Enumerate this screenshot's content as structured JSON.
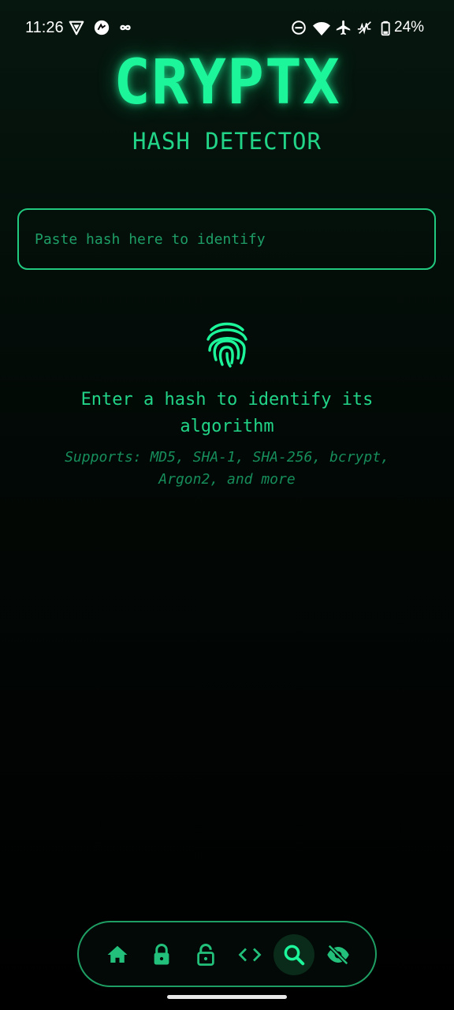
{
  "status_bar": {
    "time": "11:26",
    "battery_percent": "24%",
    "left_icons": [
      "vpn-shield-icon",
      "edge-sync-icon",
      "infinity-icon"
    ],
    "right_icons": [
      "do-not-disturb-icon",
      "wifi-icon",
      "airplane-icon",
      "signal-off-icon",
      "battery-icon"
    ]
  },
  "header": {
    "title": "CRYPTX",
    "subtitle": "HASH DETECTOR"
  },
  "search": {
    "value": "",
    "placeholder": "Paste hash here to identify"
  },
  "empty_state": {
    "icon": "fingerprint-icon",
    "message": "Enter a hash to identify its algorithm",
    "supports": "Supports: MD5, SHA-1, SHA-256, bcrypt, Argon2, and more"
  },
  "bottom_nav": {
    "items": [
      {
        "icon": "home-icon",
        "active": false
      },
      {
        "icon": "lock-icon",
        "active": false
      },
      {
        "icon": "unlock-icon",
        "active": false
      },
      {
        "icon": "code-icon",
        "active": false
      },
      {
        "icon": "search-icon",
        "active": true
      },
      {
        "icon": "eye-off-icon",
        "active": false
      }
    ]
  },
  "colors": {
    "accent": "#1cf59a",
    "accent_dim": "#22d487",
    "muted": "#168d5b",
    "background": "#000000"
  }
}
